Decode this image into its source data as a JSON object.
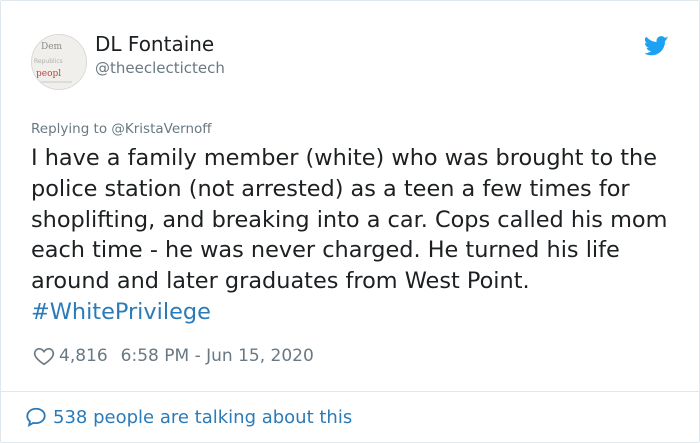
{
  "tweet": {
    "author": {
      "name": "DL Fontaine",
      "handle": "@theeclectictech",
      "avatar_text": {
        "line1": "Dem",
        "line2": "Republics",
        "line3": "peopl"
      }
    },
    "icons": {
      "brand": "twitter-bird-icon",
      "like": "heart-icon",
      "conversation": "speech-bubble-icon"
    },
    "replying_prefix": "Replying to",
    "replying_to": "@KristaVernoff",
    "text": "I have a family member (white) who was brought to the police station (not arrested) as a teen a few times for shoplifting, and breaking into a car. Cops called his mom each time - he was never charged. He turned his life around and later graduates from West Point.",
    "hashtag": "#WhitePrivilege",
    "likes": "4,816",
    "timestamp": "6:58 PM - Jun 15, 2020",
    "talking": "538 people are talking about this"
  },
  "colors": {
    "twitter_blue": "#1da1f2",
    "link_blue": "#2b7bb9",
    "meta_gray": "#697882",
    "text": "#1c2022",
    "border": "#e1e8ed"
  }
}
